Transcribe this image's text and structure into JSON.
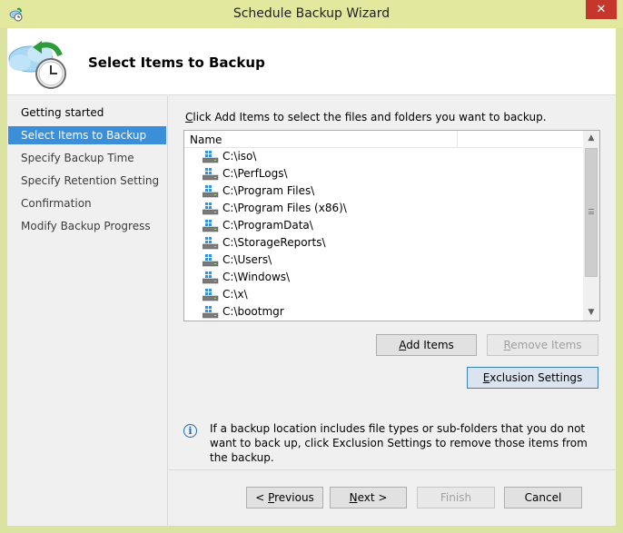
{
  "window": {
    "title": "Schedule Backup Wizard",
    "close_label": "✕"
  },
  "header": {
    "title": "Select Items to Backup"
  },
  "nav": {
    "items": [
      {
        "label": "Getting started"
      },
      {
        "label": "Select Items to Backup"
      },
      {
        "label": "Specify Backup Time"
      },
      {
        "label": "Specify Retention Setting"
      },
      {
        "label": "Confirmation"
      },
      {
        "label": "Modify Backup Progress"
      }
    ],
    "selected_index": 1
  },
  "main": {
    "instruction_prefix": "C",
    "instruction_rest": "lick Add Items to select the files and folders you want to backup.",
    "list": {
      "column_header": "Name",
      "items": [
        "C:\\iso\\",
        "C:\\PerfLogs\\",
        "C:\\Program Files\\",
        "C:\\Program Files (x86)\\",
        "C:\\ProgramData\\",
        "C:\\StorageReports\\",
        "C:\\Users\\",
        "C:\\Windows\\",
        "C:\\x\\",
        "C:\\bootmgr"
      ]
    },
    "buttons": {
      "add_items_a": "A",
      "add_items_rest": "dd Items",
      "remove_items_r": "R",
      "remove_items_rest": "emove Items",
      "exclusion_e": "E",
      "exclusion_rest": "xclusion Settings"
    },
    "info_text": "If a backup location includes file types or sub-folders that you do not want to back up, click Exclusion Settings to remove those items from the backup."
  },
  "footer": {
    "previous_prefix": "< ",
    "previous_p": "P",
    "previous_rest": "revious",
    "next_n": "N",
    "next_rest": "ext >",
    "finish_label": "Finish",
    "cancel_label": "Cancel"
  },
  "colors": {
    "selected_nav": "#3b8fd9",
    "close_button": "#c7362b",
    "title_bar": "#e2e99f"
  }
}
